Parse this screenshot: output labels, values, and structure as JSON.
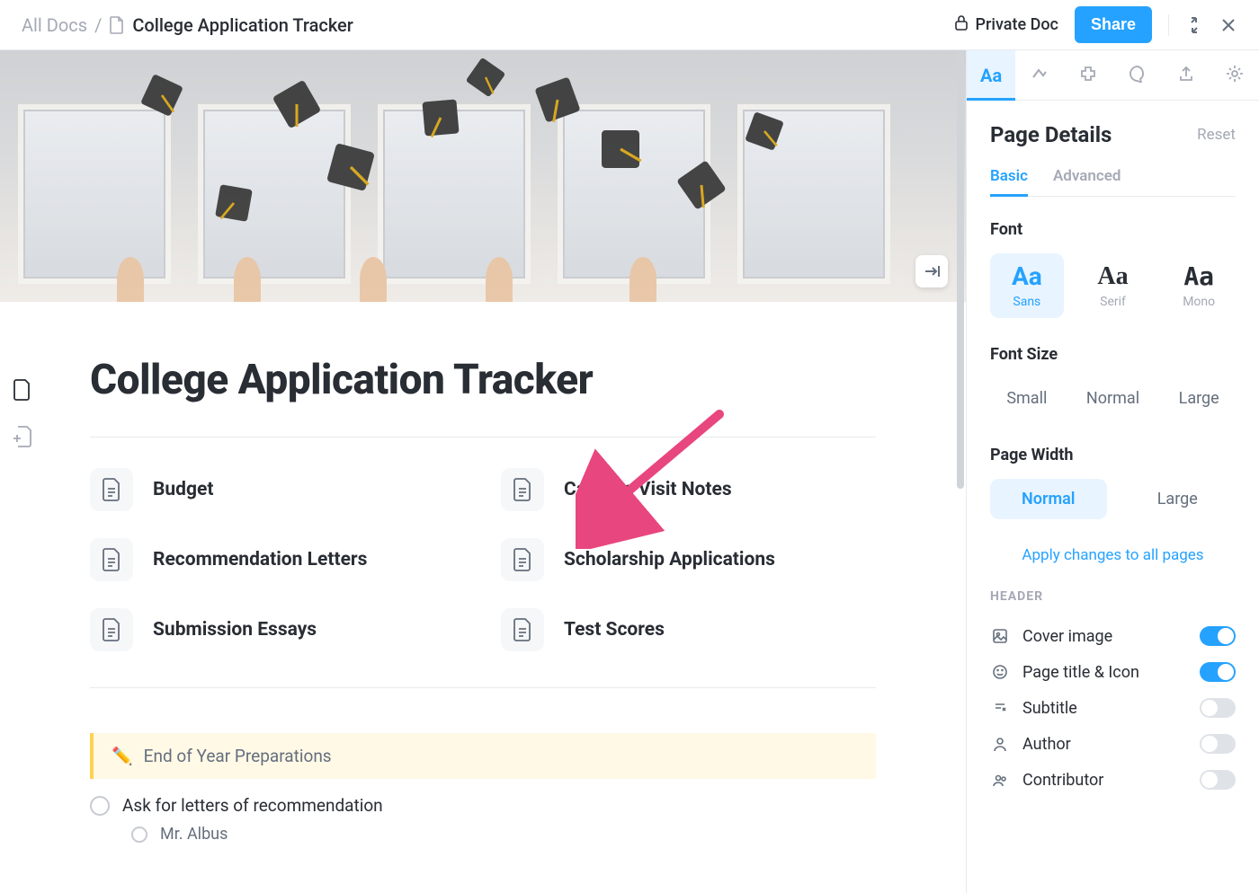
{
  "topbar": {
    "breadcrumb_root": "All Docs",
    "breadcrumb_title": "College Application Tracker",
    "private_label": "Private Doc",
    "share_label": "Share"
  },
  "doc": {
    "title": "College Application Tracker",
    "links": [
      "Budget",
      "Campus Visit Notes",
      "Recommendation Letters",
      "Scholarship Applications",
      "Submission Essays",
      "Test Scores"
    ],
    "callout_emoji": "✏️",
    "callout_text": "End of Year Preparations",
    "task": "Ask for letters of recommendation",
    "subtask": "Mr. Albus"
  },
  "panel": {
    "title": "Page Details",
    "reset": "Reset",
    "subtabs": {
      "basic": "Basic",
      "advanced": "Advanced"
    },
    "font": {
      "label": "Font",
      "sans": "Sans",
      "serif": "Serif",
      "mono": "Mono",
      "sample": "Aa"
    },
    "font_size": {
      "label": "Font Size",
      "small": "Small",
      "normal": "Normal",
      "large": "Large"
    },
    "page_width": {
      "label": "Page Width",
      "normal": "Normal",
      "large": "Large"
    },
    "apply": "Apply changes to all pages",
    "header": {
      "label": "HEADER",
      "cover": "Cover image",
      "title_icon": "Page title & Icon",
      "subtitle": "Subtitle",
      "author": "Author",
      "contributor": "Contributor"
    }
  }
}
